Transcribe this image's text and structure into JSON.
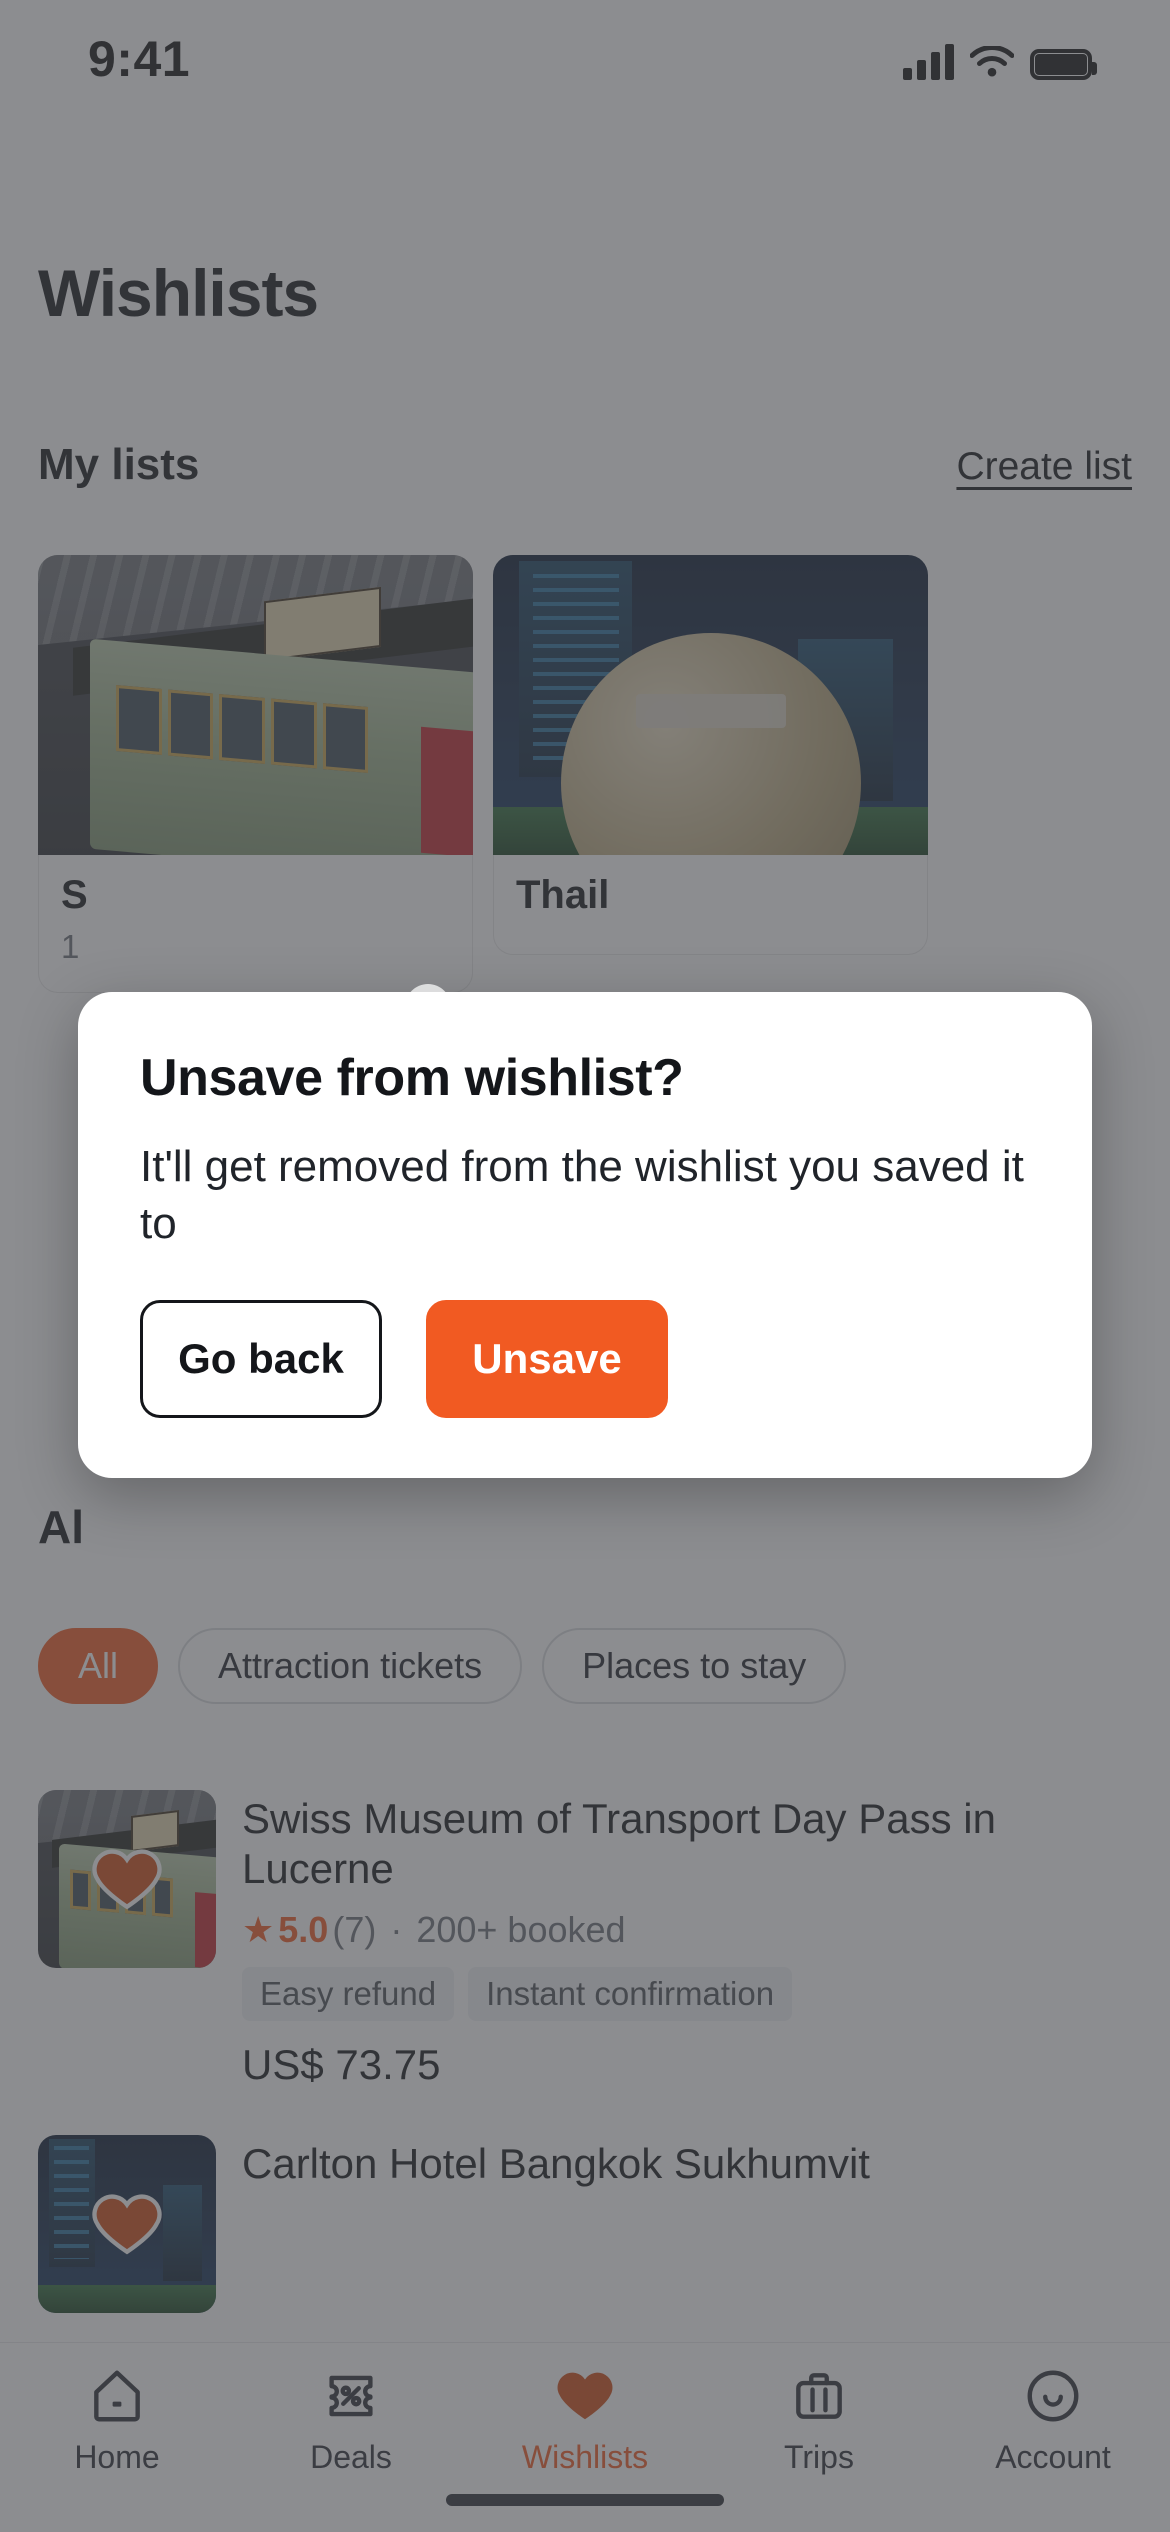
{
  "status_bar": {
    "time": "9:41",
    "icons": [
      "cellular-signal-icon",
      "wifi-icon",
      "battery-icon"
    ]
  },
  "header": {
    "title": "Wishlists"
  },
  "my_lists": {
    "section_title": "My lists",
    "create_label": "Create list",
    "cards": [
      {
        "title": "S",
        "subtitle": "1",
        "image": "swiss-tram-museum-photo"
      },
      {
        "title": "Thail",
        "subtitle": "",
        "image": "bangkok-night-photo"
      }
    ]
  },
  "all_section": {
    "heading": "Al",
    "filters": [
      {
        "label": "All",
        "selected": true
      },
      {
        "label": "Attraction tickets",
        "selected": false
      },
      {
        "label": "Places to stay",
        "selected": false
      }
    ],
    "items": [
      {
        "title": "Swiss Museum of Transport Day Pass in Lucerne",
        "star": "★",
        "rating": "5.0",
        "review_count": "(7)",
        "separator": "·",
        "booked": "200+ booked",
        "tags": [
          "Easy refund",
          "Instant confirmation"
        ],
        "price": "US$ 73.75",
        "image": "swiss-tram-museum-photo",
        "saved_icon": "heart-filled-icon"
      },
      {
        "title": "Carlton Hotel Bangkok Sukhumvit",
        "star": "★",
        "rating": "",
        "review_count": "",
        "separator": "",
        "booked": "",
        "tags": [],
        "price": "",
        "image": "bangkok-night-photo",
        "saved_icon": "heart-filled-icon"
      }
    ]
  },
  "dialog": {
    "title": "Unsave from wishlist?",
    "body": "It'll get removed from the wishlist you saved it to",
    "cancel_label": "Go back",
    "confirm_label": "Unsave"
  },
  "tab_bar": {
    "tabs": [
      {
        "label": "Home",
        "icon": "home-icon",
        "active": false
      },
      {
        "label": "Deals",
        "icon": "deals-icon",
        "active": false
      },
      {
        "label": "Wishlists",
        "icon": "heart-icon",
        "active": true
      },
      {
        "label": "Trips",
        "icon": "suitcase-icon",
        "active": false
      },
      {
        "label": "Account",
        "icon": "account-icon",
        "active": false
      }
    ]
  },
  "colors": {
    "accent": "#f15a22",
    "text": "#14161a",
    "muted": "#6b6f76",
    "overlay": "rgba(69,71,76,0.62)"
  }
}
